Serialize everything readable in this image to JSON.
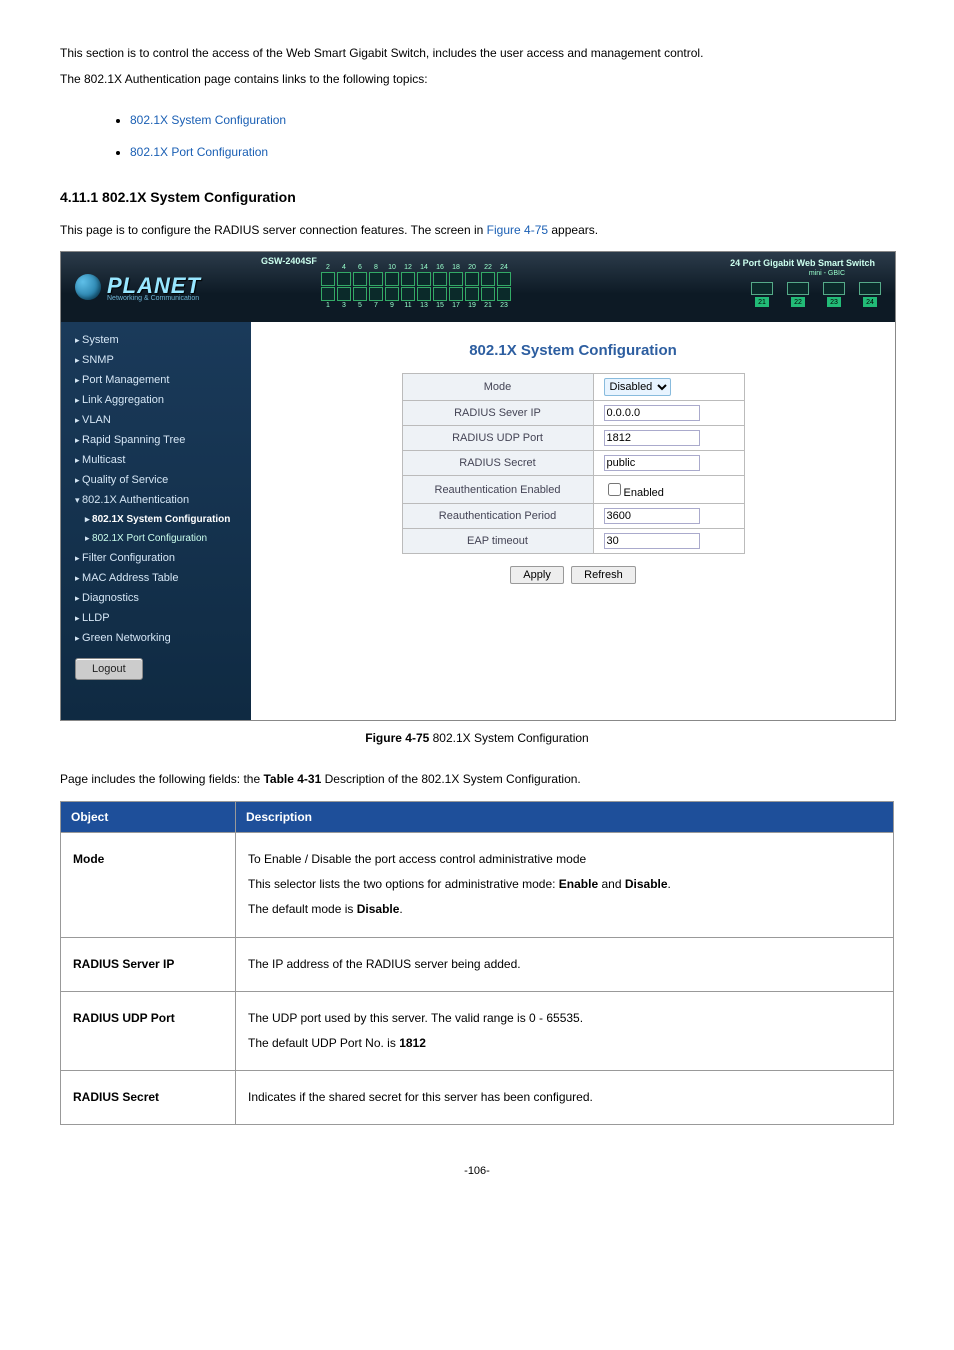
{
  "intro": {
    "line1": "This section is to control the access of the Web Smart Gigabit Switch, includes the user access and management control.",
    "line2": "The 802.1X Authentication page contains links to the following topics:"
  },
  "bullets": [
    {
      "label": "802.1X System Configuration"
    },
    {
      "label": "802.1X Port Configuration"
    }
  ],
  "section": {
    "heading": "4.11.1 802.1X System Configuration",
    "para_pre": "This page is to configure the RADIUS server connection features. The screen in ",
    "para_link": "Figure 4-75",
    "para_post": " appears."
  },
  "screenshot": {
    "model": "GSW-2404SF",
    "logo": "PLANET",
    "logo_sub": "Networking & Communication",
    "right_title": "24 Port Gigabit Web Smart Switch",
    "mini_gbic": "mini - GBIC",
    "port_tops": [
      "2",
      "4",
      "6",
      "8",
      "10",
      "12",
      "14",
      "16",
      "18",
      "20",
      "22",
      "24"
    ],
    "port_bots": [
      "1",
      "3",
      "5",
      "7",
      "9",
      "11",
      "13",
      "15",
      "17",
      "19",
      "21",
      "23"
    ],
    "gbic_nums": [
      "21",
      "22",
      "23",
      "24"
    ],
    "sidebar": [
      {
        "label": "System",
        "sub": false
      },
      {
        "label": "SNMP",
        "sub": false
      },
      {
        "label": "Port Management",
        "sub": false
      },
      {
        "label": "Link Aggregation",
        "sub": false
      },
      {
        "label": "VLAN",
        "sub": false
      },
      {
        "label": "Rapid Spanning Tree",
        "sub": false
      },
      {
        "label": "Multicast",
        "sub": false
      },
      {
        "label": "Quality of Service",
        "sub": false
      },
      {
        "label": "802.1X Authentication",
        "sub": false,
        "expanded": true
      },
      {
        "label": "802.1X System Configuration",
        "sub": true,
        "active": true
      },
      {
        "label": "802.1X Port Configuration",
        "sub": true
      },
      {
        "label": "Filter Configuration",
        "sub": false
      },
      {
        "label": "MAC Address Table",
        "sub": false
      },
      {
        "label": "Diagnostics",
        "sub": false
      },
      {
        "label": "LLDP",
        "sub": false
      },
      {
        "label": "Green Networking",
        "sub": false
      }
    ],
    "logout": "Logout",
    "main_title": "802.1X System Configuration",
    "rows": [
      {
        "lbl": "Mode",
        "val_type": "select",
        "val": "Disabled"
      },
      {
        "lbl": "RADIUS Sever IP",
        "val_type": "text",
        "val": "0.0.0.0"
      },
      {
        "lbl": "RADIUS UDP Port",
        "val_type": "text",
        "val": "1812"
      },
      {
        "lbl": "RADIUS Secret",
        "val_type": "text",
        "val": "public"
      },
      {
        "lbl": "Reauthentication Enabled",
        "val_type": "check",
        "val": "Enabled"
      },
      {
        "lbl": "Reauthentication Period",
        "val_type": "text",
        "val": "3600"
      },
      {
        "lbl": "EAP timeout",
        "val_type": "text",
        "val": "30"
      }
    ],
    "apply": "Apply",
    "refresh": "Refresh"
  },
  "figcap": {
    "strong": "Figure 4-75",
    "rest": " 802.1X System Configuration"
  },
  "desc_intro": {
    "pre": "Page includes the following fields: the ",
    "strong": "Table 4-31",
    "post": " Description of the 802.1X System Configuration."
  },
  "table": {
    "head_obj": "Object",
    "head_desc": "Description",
    "rows": [
      {
        "obj": "Mode",
        "lines": [
          {
            "text": "To Enable / Disable the port access control administrative mode"
          },
          {
            "text_pre": "This selector lists the two options for administrative mode: ",
            "b1": "Enable",
            "mid": " and ",
            "b2": "Disable",
            "post": "."
          },
          {
            "text_pre": "The default mode is ",
            "b1": "Disable",
            "post": "."
          }
        ]
      },
      {
        "obj": "RADIUS Server IP",
        "lines": [
          {
            "text": "The IP address of the RADIUS server being added."
          }
        ]
      },
      {
        "obj": "RADIUS UDP Port",
        "lines": [
          {
            "text": "The UDP port used by this server. The valid range is 0 - 65535."
          },
          {
            "text_pre": "The default UDP Port No. is ",
            "b1": "1812",
            "post": ""
          }
        ]
      },
      {
        "obj": "RADIUS Secret",
        "lines": [
          {
            "text": "Indicates if the shared secret for this server has been configured."
          }
        ]
      }
    ]
  },
  "footer": "-106-"
}
